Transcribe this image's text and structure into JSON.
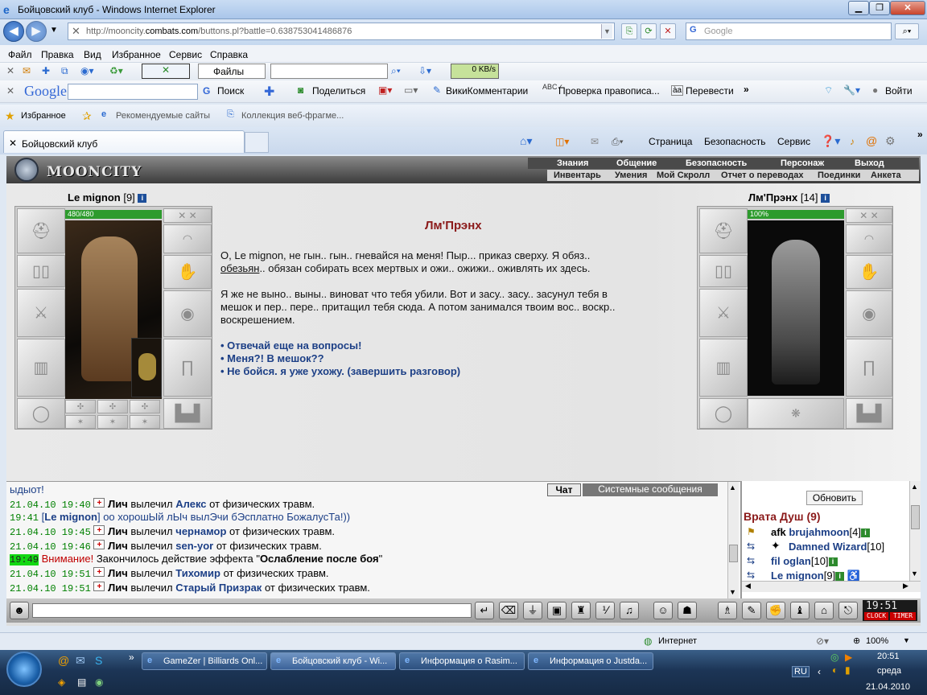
{
  "window": {
    "title": "Бойцовский клуб - Windows Internet Explorer"
  },
  "address": {
    "url_prefix": "http://mooncity.",
    "url_domain": "combats.com",
    "url_suffix": "/buttons.pl?battle=0.638753041486876",
    "search_placeholder": "Google"
  },
  "menu": [
    "Файл",
    "Правка",
    "Вид",
    "Избранное",
    "Сервис",
    "Справка"
  ],
  "toolbar1": {
    "files": "Файлы",
    "speed": "0 KB/s"
  },
  "toolbar2": {
    "google": "Google",
    "search": "Поиск",
    "share": "Поделиться",
    "wiki": "ВикиКомментарии",
    "spell": "Проверка правописа...",
    "translate": "Перевести",
    "login": "Войти"
  },
  "favbar": {
    "favorites": "Избранное",
    "suggested": "Рекомендуемые сайты",
    "gallery": "Коллекция веб-фрагме..."
  },
  "tabs": {
    "active": "Бойцовский клуб"
  },
  "cmdbar": {
    "page": "Страница",
    "safety": "Безопасность",
    "tools": "Сервис"
  },
  "game": {
    "logo": "MOONCITY",
    "menu1": [
      "Знания",
      "Общение",
      "Безопасность",
      "Персонаж",
      "Выход"
    ],
    "menu2": [
      "Инвентарь",
      "Умения",
      "Мой Скролл",
      "Отчет о переводах",
      "Поединки",
      "Анкета"
    ],
    "player": {
      "name": "Le mignon",
      "level": "[9]",
      "hp": "480/480",
      "hp_fraction": 1.0
    },
    "npc": {
      "name": "Лм'Прэнх",
      "level": "[14]",
      "hp": "100%",
      "hp_fraction": 1.0
    },
    "dialog": {
      "title": "Лм'Прэнх",
      "p1a": "О, Le mignon, не гын.. гын.. гневайся на меня! Пыр... приказ сверху. Я обяз..",
      "p1b_u": "обезьян",
      "p1b": ".. обязан собирать всех мертвых и ожи.. ожижи.. оживлять их здесь.",
      "p2a": "Я же не выно.. выны.. виноват что тебя убили. Вот и засу.. засу.. засунул тебя в",
      "p2b": "мешок и пер.. пере.. притащил тебя сюда. А потом занимался твоим вос.. воскр..",
      "p2c": "воскрешением.",
      "answers": [
        "Отвечай еще на вопросы!",
        "Меня?! В мешок??",
        "Не бойся. я уже ухожу. (завершить разговор)"
      ]
    },
    "chat": {
      "tab_chat": "Чат",
      "tab_system": "Системные сообщения",
      "lines": [
        {
          "head": "ыдыот!"
        },
        {
          "ts": "21.04.10 19:40",
          "who": "Лич",
          "mid": "вылечил",
          "target": "Алекс",
          "tail": "от физических травм."
        },
        {
          "ts": "19:41",
          "nick": "Le mignon",
          "msg": "оо хорошЫй лЫч вылЭчи бЭсплатно БожалусТа!))"
        },
        {
          "ts": "21.04.10 19:45",
          "who": "Лич",
          "mid": "вылечил",
          "target": "чернамор",
          "tail": "от физических травм."
        },
        {
          "ts": "21.04.10 19:46",
          "who": "Лич",
          "mid": "вылечил",
          "target": "sen-yor",
          "tail": "от физических травм."
        },
        {
          "ts": "19:49",
          "warn": "Внимание!",
          "text": "Закончилось действие эффекта \"",
          "effect": "Ослабление после боя",
          "end": "\""
        },
        {
          "ts": "21.04.10 19:51",
          "who": "Лич",
          "mid": "вылечил",
          "target": "Тихомир",
          "tail": "от физических травм."
        },
        {
          "ts": "21.04.10 19:51",
          "who": "Лич",
          "mid": "вылечил",
          "target": "Старый Призрак",
          "tail": "от физических травм."
        }
      ]
    },
    "online": {
      "refresh": "Обновить",
      "location": "Врата Душ (9)",
      "users": [
        {
          "prefix": "afk",
          "name": "brujahmoon",
          "level": "[4]"
        },
        {
          "prefix": "",
          "name": "Damned Wizard",
          "level": "[10]"
        },
        {
          "prefix": "fil",
          "name": "oglan",
          "level": "[10]"
        },
        {
          "prefix": "",
          "name": "Le mignon",
          "level": "[9]"
        }
      ]
    },
    "clock": "19:51",
    "clock_labels": {
      "clock": "CLOCK",
      "timer": "TIMER"
    }
  },
  "statusbar": {
    "zone": "Интернет",
    "zoom": "100%"
  },
  "taskbar": {
    "tasks": [
      "GameZer | Billiards Onl...",
      "Бойцовский клуб - Wi...",
      "Информация о Rasim...",
      "Информация о Justda..."
    ],
    "lang": "RU",
    "time": "20:51",
    "day": "среда",
    "date": "21.04.2010"
  }
}
